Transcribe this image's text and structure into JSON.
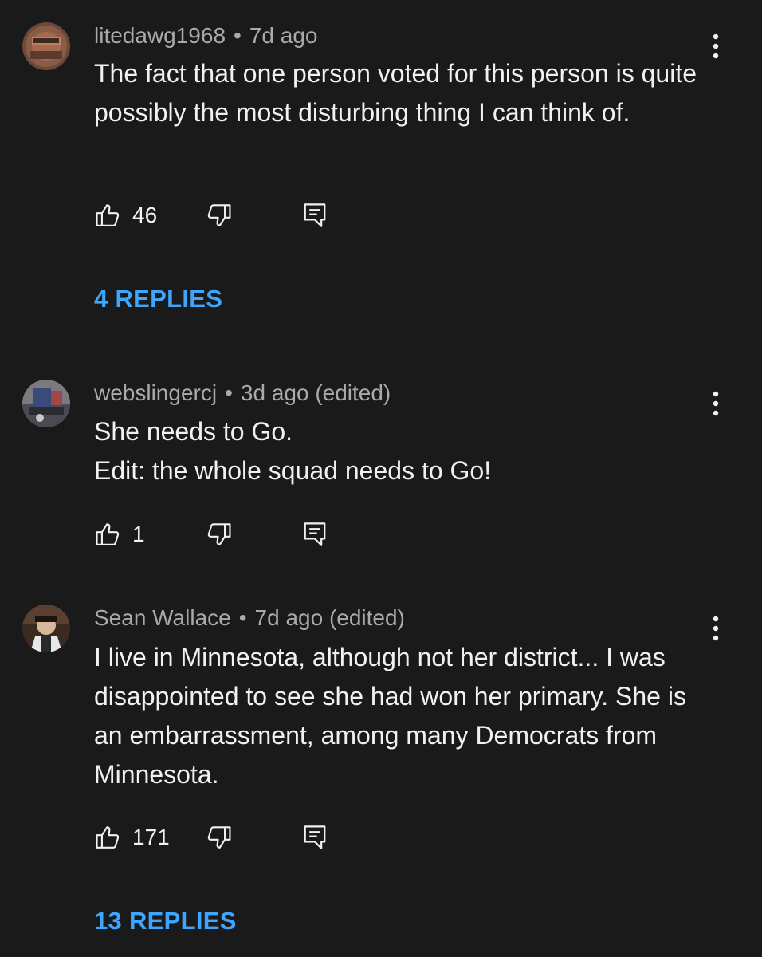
{
  "comments": [
    {
      "author": "litedawg1968",
      "time": "7d ago",
      "edited": "",
      "text": "The fact that one person voted for this person is quite possibly the most disturbing thing I can think of.",
      "likes": "46",
      "replies": "4 REPLIES",
      "avatar_icon": "avatar-image"
    },
    {
      "author": "webslingercj",
      "time": "3d ago",
      "edited": "(edited)",
      "text": "She needs to Go.\nEdit: the whole squad needs to Go!",
      "likes": "1",
      "replies": "",
      "avatar_icon": "avatar-image"
    },
    {
      "author": "Sean Wallace",
      "time": "7d ago",
      "edited": "(edited)",
      "text": "I live in Minnesota, although not her district... I was disappointed to see she had won her primary. She is an embarrassment, among many Democrats from Minnesota.",
      "likes": "171",
      "replies": "13 REPLIES",
      "avatar_icon": "avatar-image"
    }
  ],
  "separator": "•",
  "colors": {
    "background": "#1a1a1a",
    "text": "#f1f1f1",
    "meta": "#aaaaaa",
    "link": "#3ea6ff"
  }
}
